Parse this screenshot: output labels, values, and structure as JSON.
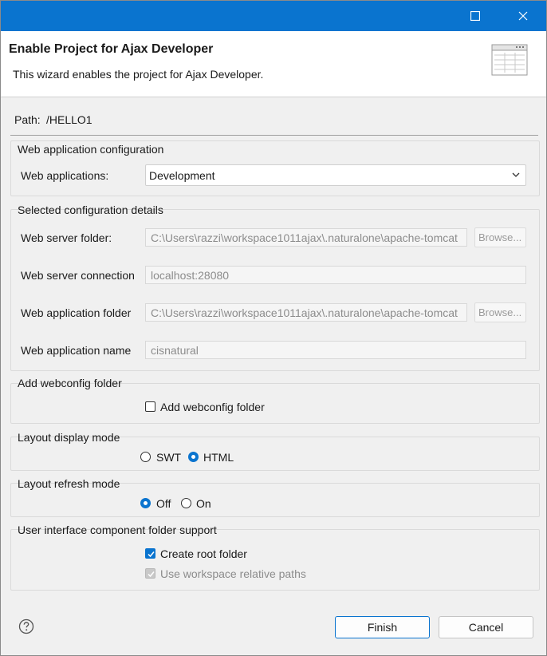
{
  "header": {
    "title": "Enable Project for Ajax Developer",
    "description": "This wizard enables the project for Ajax Developer."
  },
  "path": {
    "label": "Path:",
    "value": "/HELLO1"
  },
  "web_app_config": {
    "title": "Web application configuration",
    "label": "Web applications:",
    "selected": "Development"
  },
  "config_details": {
    "title": "Selected configuration details",
    "server_folder_label": "Web server folder:",
    "server_folder_value": "C:\\Users\\razzi\\workspace1011ajax\\.naturalone\\apache-tomcat",
    "server_connection_label": "Web server connection",
    "server_connection_value": "localhost:28080",
    "app_folder_label": "Web application folder",
    "app_folder_value": "C:\\Users\\razzi\\workspace1011ajax\\.naturalone\\apache-tomcat",
    "app_name_label": "Web application name",
    "app_name_value": "cisnatural",
    "browse_label": "Browse..."
  },
  "webconfig": {
    "title": "Add webconfig folder",
    "checkbox_label": "Add webconfig folder",
    "checked": false
  },
  "layout_display": {
    "title": "Layout display mode",
    "options": [
      "SWT",
      "HTML"
    ],
    "selected": "HTML"
  },
  "layout_refresh": {
    "title": "Layout refresh mode",
    "options": [
      "Off",
      "On"
    ],
    "selected": "Off"
  },
  "ui_component": {
    "title": "User interface component folder support",
    "create_root_label": "Create root folder",
    "create_root_checked": true,
    "workspace_relative_label": "Use workspace relative paths",
    "workspace_relative_checked": true,
    "workspace_relative_enabled": false
  },
  "buttons": {
    "finish": "Finish",
    "cancel": "Cancel"
  },
  "colors": {
    "titlebar": "#0a74cf",
    "accent": "#0a74cf",
    "background": "#f0f0f0"
  }
}
